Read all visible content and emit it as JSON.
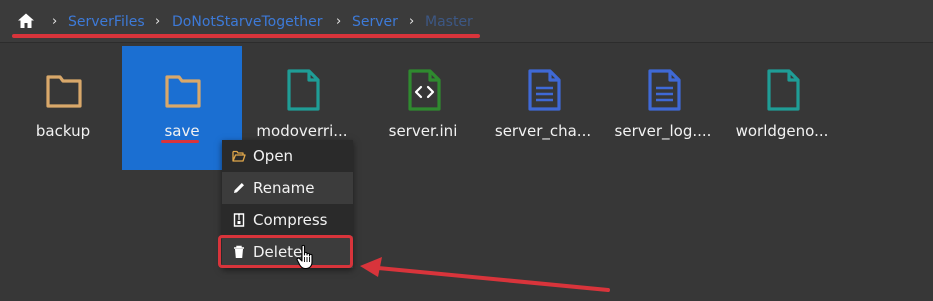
{
  "breadcrumb": {
    "home_icon": "home-icon",
    "items": [
      "ServerFiles",
      "DoNotStarveTogether",
      "Server",
      "Master"
    ],
    "separator": "›"
  },
  "files": [
    {
      "name": "backup",
      "type": "folder",
      "icon": "folder-icon",
      "selected": false
    },
    {
      "name": "save",
      "type": "folder",
      "icon": "folder-icon",
      "selected": true
    },
    {
      "name": "modoverri...",
      "type": "file",
      "icon": "document-icon",
      "selected": false
    },
    {
      "name": "server.ini",
      "type": "code",
      "icon": "code-file-icon",
      "selected": false
    },
    {
      "name": "server_cha...",
      "type": "text",
      "icon": "text-file-icon",
      "selected": false
    },
    {
      "name": "server_log....",
      "type": "text",
      "icon": "text-file-icon",
      "selected": false
    },
    {
      "name": "worldgeno...",
      "type": "file",
      "icon": "document-icon",
      "selected": false
    }
  ],
  "context_menu": {
    "items": [
      {
        "label": "Open",
        "icon": "folder-open-icon"
      },
      {
        "label": "Rename",
        "icon": "pencil-icon"
      },
      {
        "label": "Compress",
        "icon": "archive-icon"
      },
      {
        "label": "Delete",
        "icon": "trash-icon"
      }
    ],
    "highlighted": "Delete"
  },
  "colors": {
    "background": "#373737",
    "selection": "#1b6fd2",
    "link": "#3d7ad8",
    "annotation_red": "#d8343b",
    "folder": "#d9a86a",
    "teal_file": "#1f9d96",
    "green_code": "#2f8a2f",
    "blue_text_file": "#3f69d6"
  }
}
